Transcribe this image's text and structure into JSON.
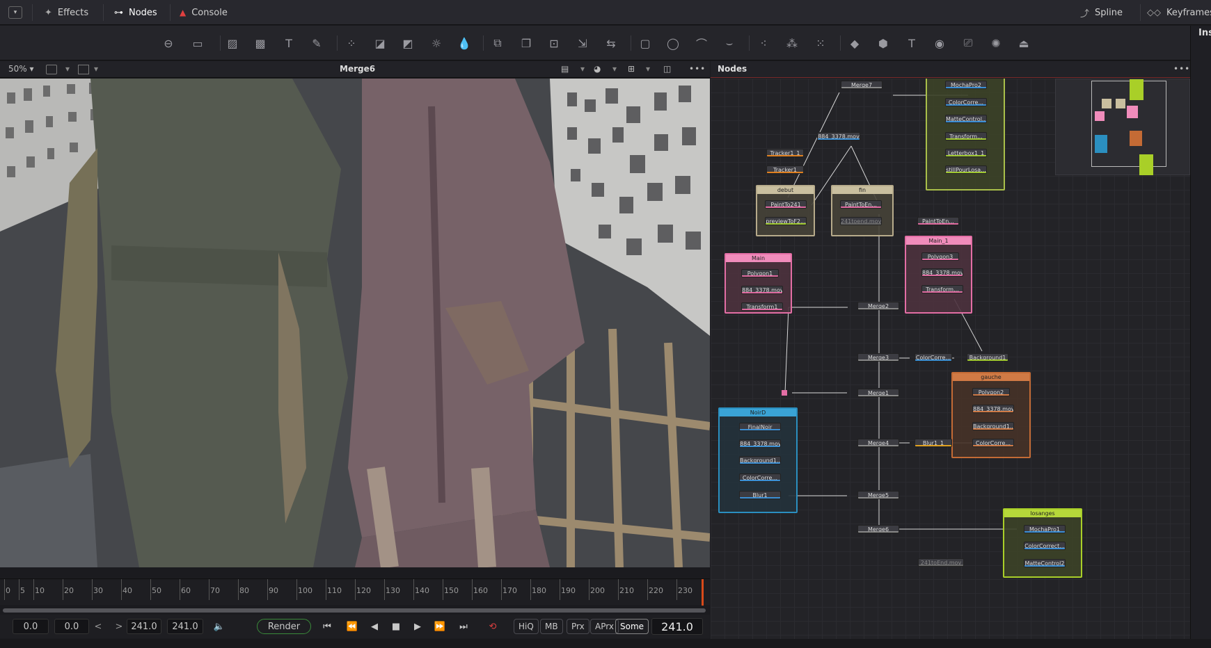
{
  "topbar": {
    "effects_label": "Effects",
    "nodes_label": "Nodes",
    "console_label": "Console",
    "spline_label": "Spline",
    "keyframes_label": "Keyframes"
  },
  "inspector": {
    "label": "Ins"
  },
  "viewer": {
    "zoom": "50%",
    "title": "Merge6"
  },
  "nodes_panel": {
    "title": "Nodes"
  },
  "timeline": {
    "ticks": [
      "0",
      "5",
      "10",
      "20",
      "30",
      "40",
      "50",
      "60",
      "70",
      "80",
      "90",
      "100",
      "110",
      "120",
      "130",
      "140",
      "150",
      "160",
      "170",
      "180",
      "190",
      "200",
      "210",
      "220",
      "230"
    ]
  },
  "transport": {
    "start_time": "0.0",
    "current_start": "0.0",
    "end_time": "241.0",
    "render_end": "241.0",
    "render_label": "Render",
    "hiq": "HiQ",
    "mb": "MB",
    "prx": "Prx",
    "aprx": "APrx",
    "some": "Some",
    "frame": "241.0"
  },
  "graph": {
    "groups": {
      "debut": "debut",
      "fin": "fin",
      "main": "Main",
      "main1": "Main_1",
      "noird": "NoirD",
      "gauche": "gauche",
      "losanges": "losanges"
    },
    "nodes": {
      "merge7": "Merge7",
      "mov_top": "884_3378.mov",
      "tracker1_1": "Tracker1_1",
      "tracker1": "Tracker1",
      "paintto241": "PaintTo241",
      "previewtof2": "previewToF2...",
      "painttoen_fin": "PaintToEn...",
      "end241_fin": "241toend.mov",
      "painttoen_solo": "PaintToEn...",
      "mochapro2": "MochaPro2",
      "colorcorre_r": "ColorCorre...",
      "mattecontrol_r": "MatteControl...",
      "transform_r": "Transform...",
      "letterbox": "Letterbox1_1",
      "stillpourlosa": "stillPourLosa...",
      "polygon1": "Polygon1",
      "mov_main": "884_3378.mov",
      "transform1": "Transform1",
      "polygon3": "Polygon3",
      "mov_main1": "884_3378.mov",
      "transform_main1": "Transform...",
      "merge2": "Merge2",
      "merge3": "Merge3",
      "colorcorre_mid": "ColorCorre...",
      "background1": "Background1",
      "merge1": "Merge1",
      "finalnoir": "FinalNoir",
      "mov_noird": "884_3378.mov",
      "background_noird": "Background1...",
      "colorcorre_noird": "ColorCorre...",
      "blur1": "Blur1",
      "polygon2": "Polygon2",
      "mov_gauche": "884_3378.mov",
      "background_gauche": "Background1...",
      "colorcorre_gauche": "ColorCorre...",
      "merge4": "Merge4",
      "blur1_1": "Blur1_1",
      "merge5": "Merge5",
      "merge6": "Merge6",
      "end241_bottom": "241toEnd.mov",
      "mochapro1": "MochaPro1",
      "colorcorrect_l": "ColorCorrect...",
      "mattecontrol2": "MatteControl2"
    }
  }
}
